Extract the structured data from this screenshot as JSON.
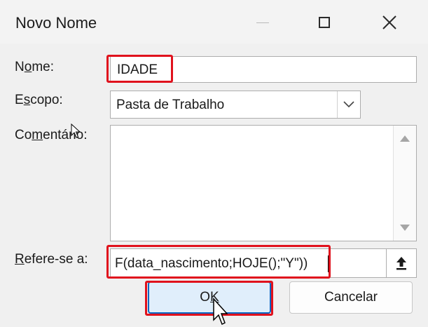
{
  "dialog": {
    "title": "Novo Nome"
  },
  "labels": {
    "name_prefix": "N",
    "name_underlined": "o",
    "name_suffix": "me:",
    "scope_prefix": "E",
    "scope_underlined": "s",
    "scope_suffix": "copo:",
    "comment_prefix": "Co",
    "comment_underlined": "m",
    "comment_suffix": "entário:",
    "refers_underlined": "R",
    "refers_suffix": "efere-se a:"
  },
  "fields": {
    "name_value": "IDADE",
    "scope_value": "Pasta de Trabalho",
    "comment_value": "",
    "refers_value": "F(data_nascimento;HOJE();\"Y\"))"
  },
  "buttons": {
    "ok_prefix": "O",
    "ok_underlined": "K",
    "cancel": "Cancelar"
  },
  "colors": {
    "highlight": "#e0121d",
    "ok_border": "#0a66c2",
    "ok_fill": "#e0eefb"
  },
  "icons": {
    "minimize": "minimize-icon",
    "maximize": "maximize-icon",
    "close": "close-icon",
    "dropdown": "chevron-down-icon",
    "collapse": "upload-arrow-icon"
  }
}
